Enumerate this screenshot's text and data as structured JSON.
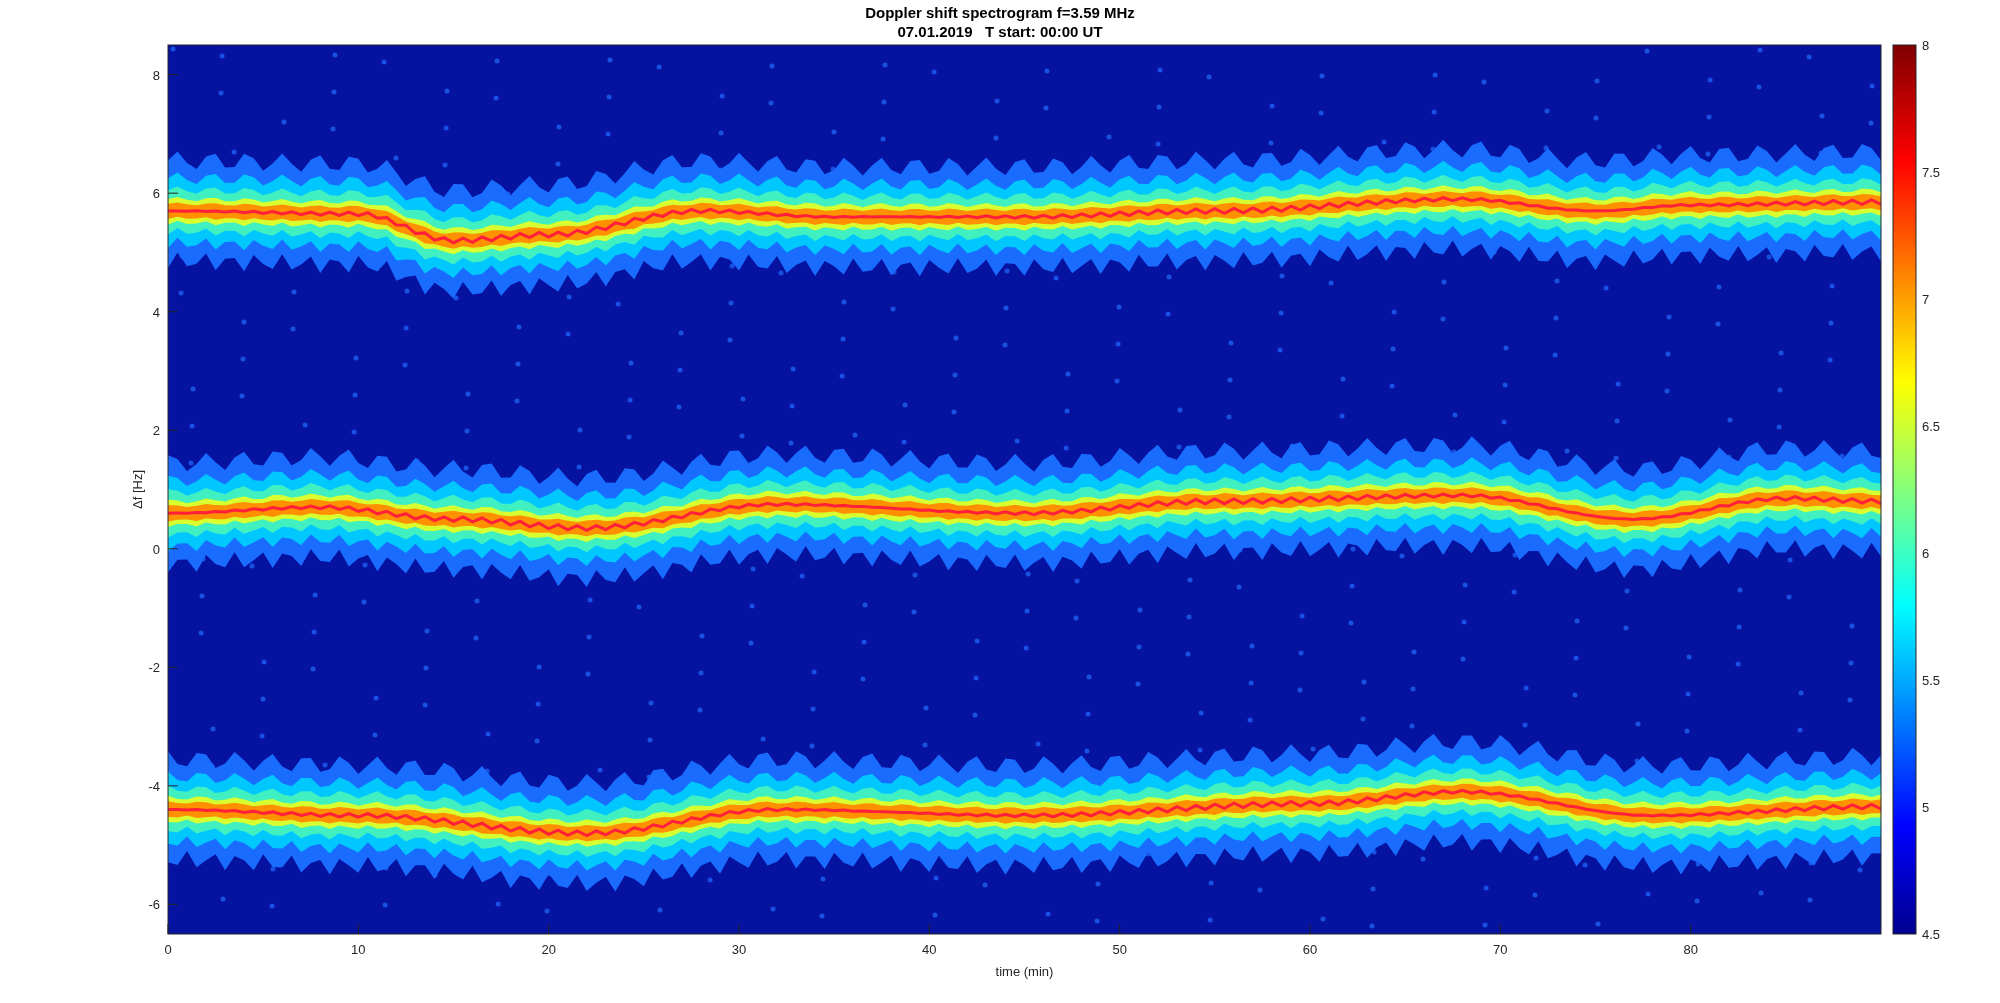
{
  "figure": {
    "title_lines": [
      "Doppler shift spectrogram f=3.59 MHz",
      "07.01.2019   T start: 00:00 UT"
    ],
    "xlabel": "time (min)",
    "ylabel": "Δf [Hz]",
    "xticks": [
      "0",
      "10",
      "20",
      "30",
      "40",
      "50",
      "60",
      "70",
      "80"
    ],
    "yticks": [
      "8",
      "6",
      "4",
      "2",
      "0",
      "-2",
      "-4",
      "-6"
    ],
    "colorbar_ticks": [
      "8",
      "7.5",
      "7",
      "6.5",
      "6",
      "5.5",
      "5",
      "4.5"
    ]
  }
}
